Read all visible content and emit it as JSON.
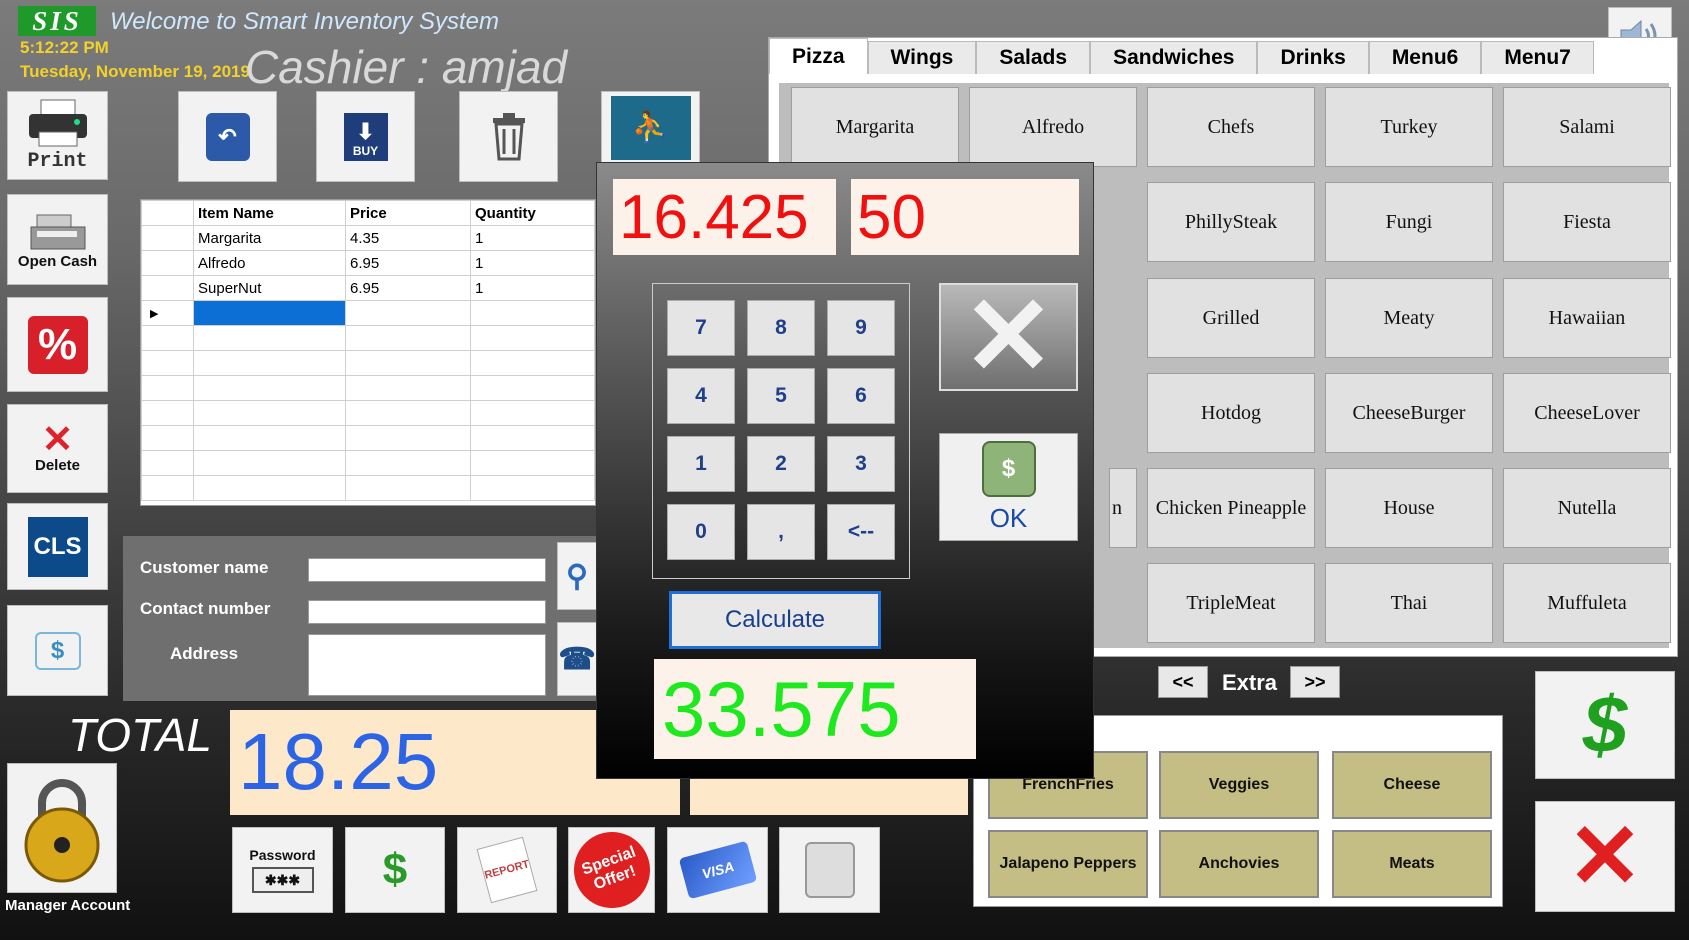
{
  "header": {
    "logo": "SIS",
    "welcome": "Welcome to Smart Inventory System",
    "time": "5:12:22 PM",
    "date": "Tuesday, November 19, 2019",
    "cashier_label": "Cashier : amjad"
  },
  "left_buttons": {
    "print": "Print",
    "open_cash": "Open Cash",
    "delete": "Delete",
    "cls": "CLS",
    "manager": "Manager Account"
  },
  "top_buttons": {
    "return": "Return",
    "buy": "BUY"
  },
  "grid": {
    "columns": [
      "Item Name",
      "Price",
      "Quantity"
    ],
    "rows": [
      [
        "Margarita",
        "4.35",
        "1"
      ],
      [
        "Alfredo",
        "6.95",
        "1"
      ],
      [
        "SuperNut",
        "6.95",
        "1"
      ]
    ]
  },
  "customer": {
    "name_label": "Customer name",
    "contact_label": "Contact number",
    "address_label": "Address",
    "name_value": "",
    "contact_value": "",
    "address_value": ""
  },
  "total": {
    "label": "TOTAL",
    "value": "18.25"
  },
  "bottom_buttons": {
    "password": "Password"
  },
  "menu": {
    "tabs": [
      "Pizza",
      "Wings",
      "Salads",
      "Sandwiches",
      "Drinks",
      "Menu6",
      "Menu7"
    ],
    "active_tab": "Pizza",
    "items": [
      "Margarita",
      "Alfredo",
      "Chefs",
      "Turkey",
      "Salami",
      "PhillySteak",
      "Fungi",
      "Fiesta",
      "Grilled",
      "Meaty",
      "Hawaiian",
      "Hotdog",
      "CheeseBurger",
      "CheeseLover",
      "n",
      "Chicken Pineapple",
      "House",
      "Nutella",
      "TripleMeat",
      "Thai",
      "Muffuleta"
    ]
  },
  "extras": {
    "prev": "<<",
    "label": "Extra",
    "next": ">>",
    "items": [
      "FrenchFries",
      "Veggies",
      "Cheese",
      "Jalapeno Peppers",
      "Anchovies",
      "Meats"
    ]
  },
  "popup": {
    "amount": "16.425",
    "paid": "50",
    "keys": [
      "7",
      "8",
      "9",
      "4",
      "5",
      "6",
      "1",
      "2",
      "3",
      "0",
      ",",
      "<--"
    ],
    "calculate": "Calculate",
    "ok": "OK",
    "result": "33.575"
  },
  "colors": {
    "total_text": "#2c64e6",
    "result_text": "#1ee81e",
    "amount_text": "#f01010",
    "welcome_text": "#cfe8ff",
    "clock_text": "#f2d12a"
  }
}
